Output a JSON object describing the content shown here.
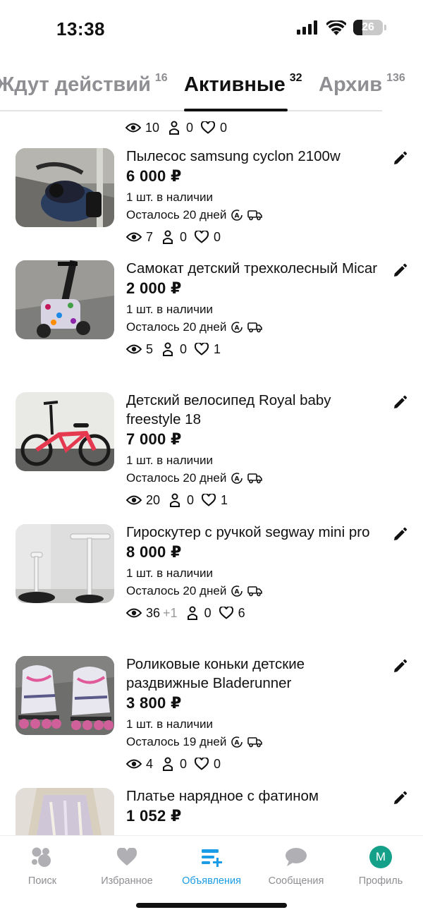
{
  "status_bar": {
    "time": "13:38",
    "battery": "26"
  },
  "tabs": [
    {
      "label": "Ждут действий",
      "count": "16"
    },
    {
      "label": "Активные",
      "count": "32"
    },
    {
      "label": "Архив",
      "count": "136"
    }
  ],
  "top_stats": {
    "views": "10",
    "contacts": "0",
    "favorites": "0"
  },
  "items": [
    {
      "title": "Пылесос samsung cyclon 2100w",
      "price": "6 000 ₽",
      "stock": "1 шт. в наличии",
      "remaining": "Осталось 20 дней",
      "views": "7",
      "views_delta": "",
      "contacts": "0",
      "favorites": "0"
    },
    {
      "title": "Самокат детский трехколесный Micar",
      "price": "2 000 ₽",
      "stock": "1 шт. в наличии",
      "remaining": "Осталось 20 дней",
      "views": "5",
      "views_delta": "",
      "contacts": "0",
      "favorites": "1"
    },
    {
      "title": "Детский велосипед Royal baby freestyle 18",
      "price": "7 000 ₽",
      "stock": "1 шт. в наличии",
      "remaining": "Осталось 20 дней",
      "views": "20",
      "views_delta": "",
      "contacts": "0",
      "favorites": "1"
    },
    {
      "title": "Гироскутер с ручкой segway mini pro",
      "price": "8 000 ₽",
      "stock": "1 шт. в наличии",
      "remaining": "Осталось 20 дней",
      "views": "36",
      "views_delta": "+1",
      "contacts": "0",
      "favorites": "6"
    },
    {
      "title": "Роликовые коньки детские раздвижные Bladerunner",
      "price": "3 800 ₽",
      "stock": "1 шт. в наличии",
      "remaining": "Осталось 19 дней",
      "views": "4",
      "views_delta": "",
      "contacts": "0",
      "favorites": "0"
    },
    {
      "title": "Платье нарядное с фатином",
      "price": "1 052 ₽"
    }
  ],
  "bottom_nav": [
    {
      "label": "Поиск",
      "icon": "search-dots-icon"
    },
    {
      "label": "Избранное",
      "icon": "heart-icon"
    },
    {
      "label": "Объявления",
      "icon": "listings-add-icon",
      "active": true
    },
    {
      "label": "Сообщения",
      "icon": "chat-bubble-icon"
    },
    {
      "label": "Профиль",
      "icon": "avatar",
      "avatar_letter": "М"
    }
  ],
  "colors": {
    "accent": "#1a9ce6",
    "avatar_bg": "#15a08a",
    "muted": "#8e8e93"
  }
}
